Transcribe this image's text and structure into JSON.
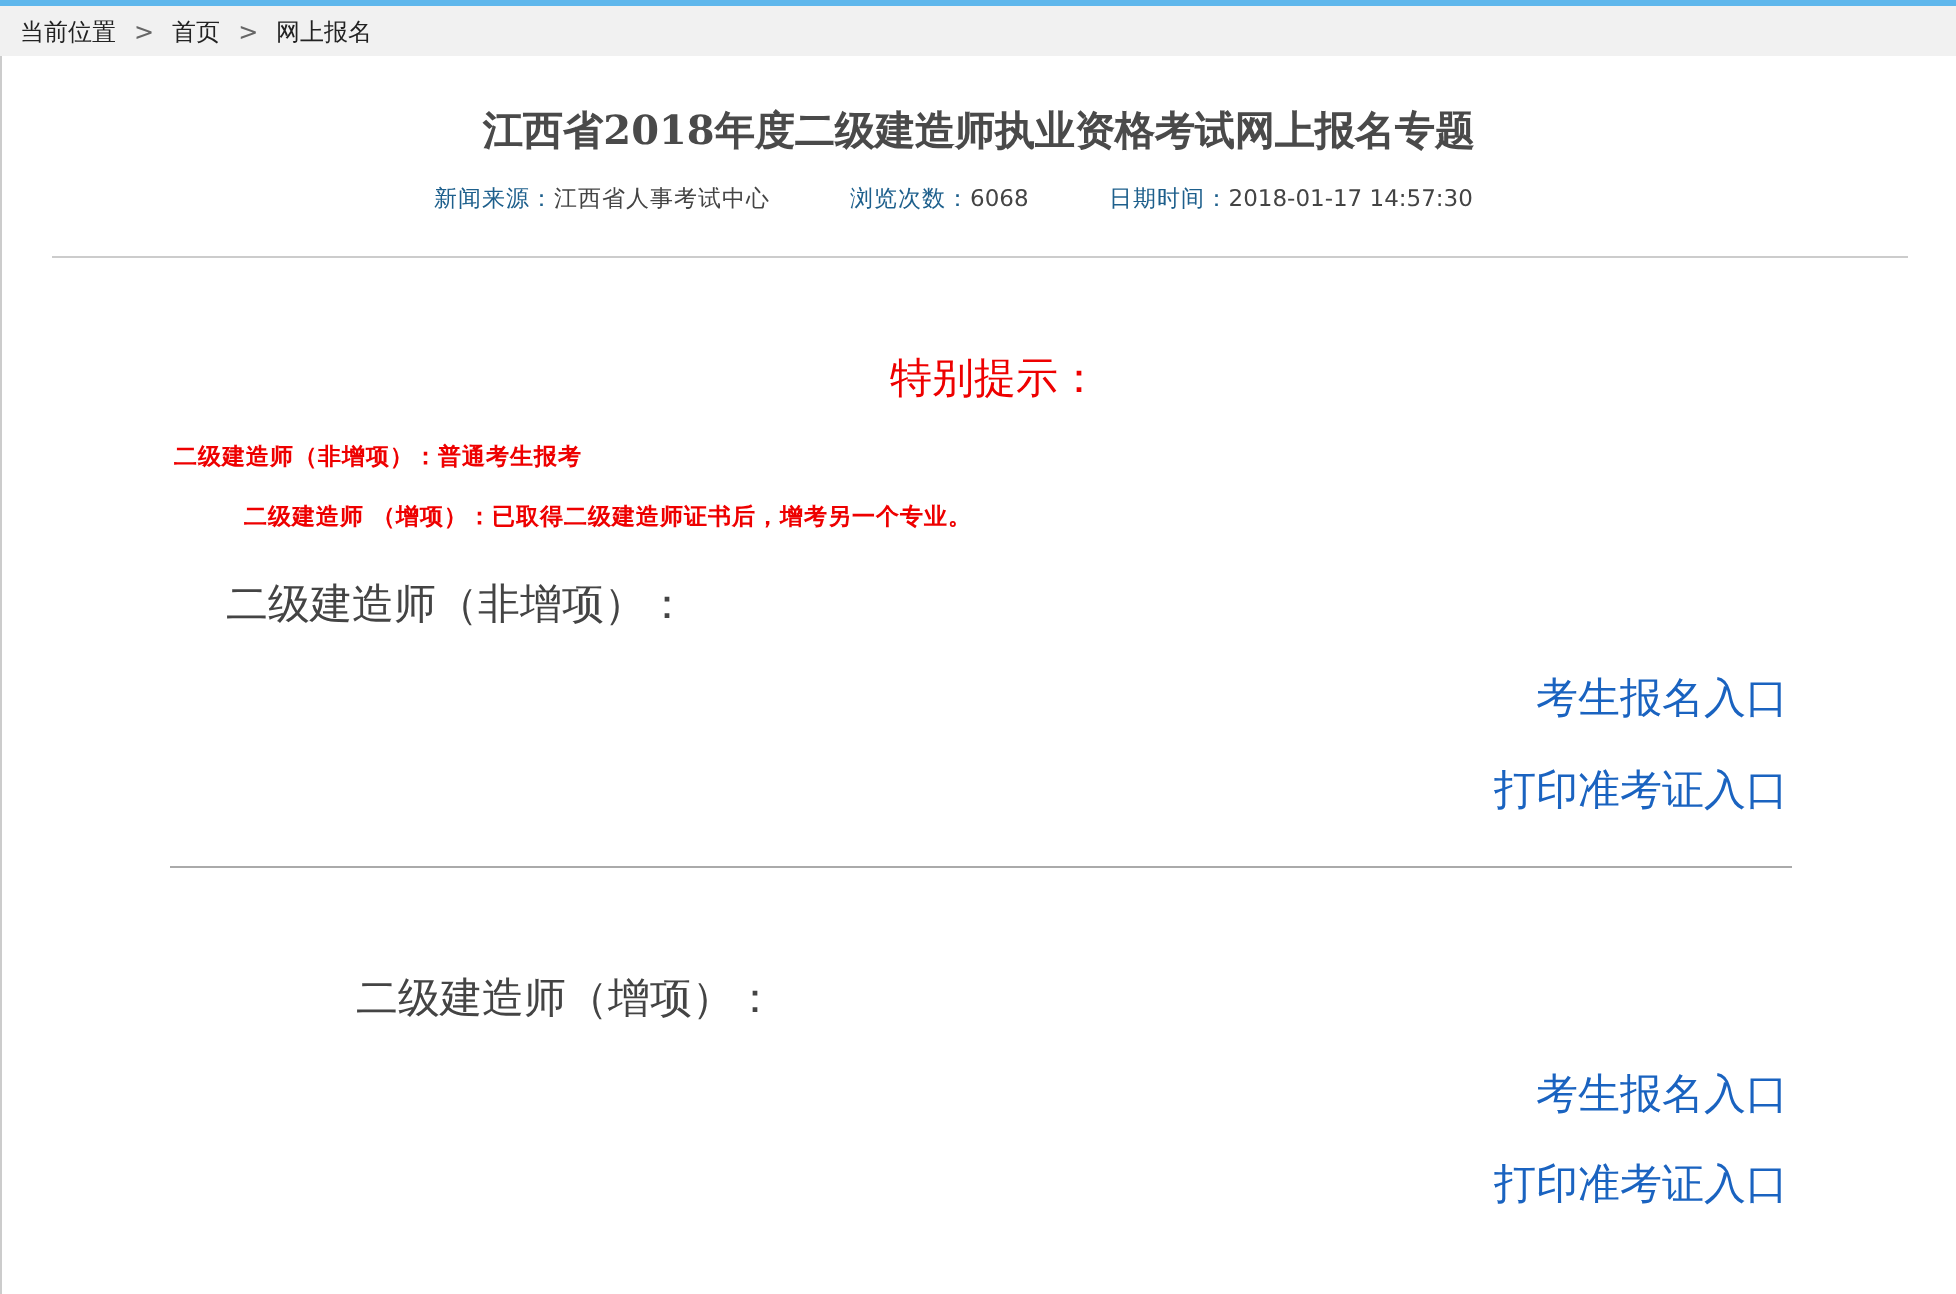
{
  "breadcrumb": [
    {
      "label": "当前位置"
    },
    {
      "label": "首页"
    },
    {
      "label": "网上报名"
    }
  ],
  "breadcrumb_separator": ">",
  "title": "江西省2018年度二级建造师执业资格考试网上报名专题",
  "meta": [
    {
      "label": "新闻来源：",
      "value": "江西省人事考试中心"
    },
    {
      "label": "浏览次数：",
      "value": "6068"
    },
    {
      "label": "日期时间：",
      "value": "2018-01-17 14:57:30"
    }
  ],
  "notice": {
    "heading": "特别提示：",
    "lines": [
      "二级建造师（非增项）：普通考生报考",
      "二级建造师 （增项）：已取得二级建造师证书后，增考另一个专业。"
    ]
  },
  "sections": [
    {
      "heading": "二级建造师（非增项）：",
      "links": [
        "考生报名入口",
        "打印准考证入口"
      ]
    },
    {
      "heading": "二级建造师（增项）：",
      "links": [
        "考生报名入口",
        "打印准考证入口"
      ]
    }
  ]
}
